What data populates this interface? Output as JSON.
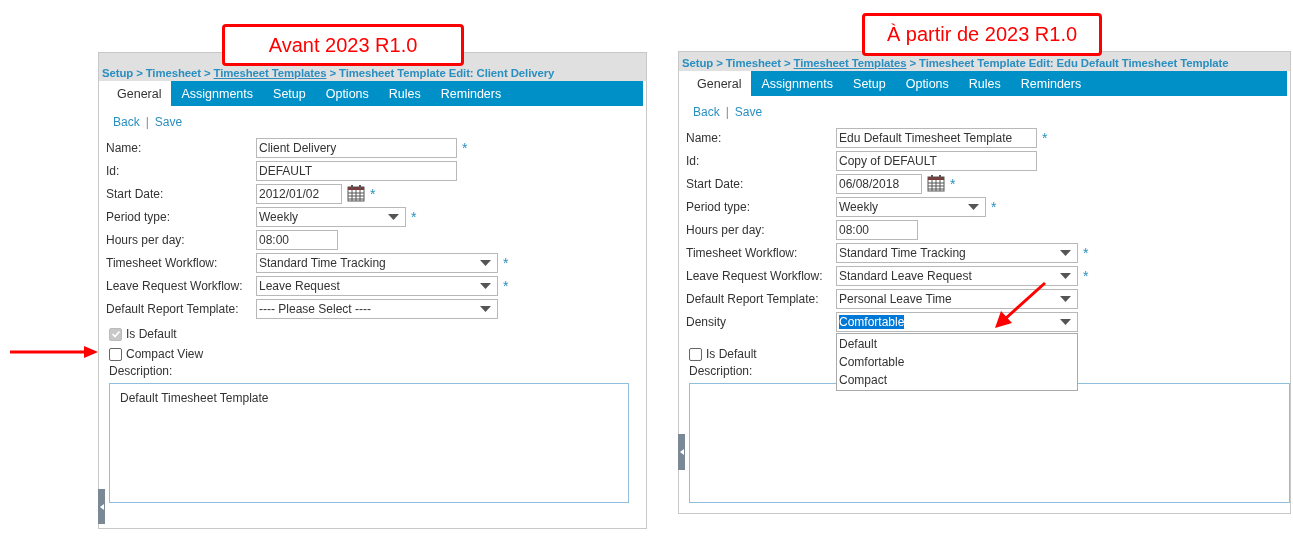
{
  "panels": [
    {
      "banner": "Avant 2023 R1.0",
      "breadcrumb": {
        "separator": ">",
        "items": [
          {
            "text": "Setup",
            "underlined": false
          },
          {
            "text": "Timesheet",
            "underlined": false
          },
          {
            "text": "Timesheet Templates",
            "underlined": true
          },
          {
            "text": "Timesheet Template Edit: Client Delivery",
            "underlined": false
          }
        ]
      },
      "tabs": [
        {
          "label": "General",
          "selected": true
        },
        {
          "label": "Assignments",
          "selected": false
        },
        {
          "label": "Setup",
          "selected": false
        },
        {
          "label": "Options",
          "selected": false
        },
        {
          "label": "Rules",
          "selected": false
        },
        {
          "label": "Reminders",
          "selected": false
        }
      ],
      "actions": {
        "separator": "|",
        "links": [
          "Back",
          "Save"
        ]
      },
      "fields": [
        {
          "label": "Name:",
          "value": "Client Delivery",
          "kind": "text",
          "required_mark": "*"
        },
        {
          "label": "Id:",
          "value": "DEFAULT",
          "kind": "text"
        },
        {
          "label": "Start Date:",
          "value": "2012/01/02",
          "kind": "date",
          "required_mark": "*"
        },
        {
          "label": "Period type:",
          "value": "Weekly",
          "kind": "dropdown",
          "required_mark": "*"
        },
        {
          "label": "Hours per day:",
          "value": "08:00",
          "kind": "time"
        },
        {
          "label": "Timesheet Workflow:",
          "value": "Standard Time Tracking",
          "kind": "wide-dropdown",
          "required_mark": "*"
        },
        {
          "label": "Leave Request Workflow:",
          "value": "Leave Request",
          "kind": "wide-dropdown",
          "required_mark": "*"
        },
        {
          "label": "Default Report Template:",
          "value": "---- Please Select ----",
          "kind": "wide-dropdown"
        }
      ],
      "checkboxes": [
        {
          "label": "Is Default",
          "checked": true,
          "disabled": true
        },
        {
          "label": "Compact View",
          "checked": false,
          "disabled": false
        }
      ],
      "description": {
        "label": "Description:",
        "value": "Default Timesheet Template"
      }
    },
    {
      "banner": "À partir de 2023 R1.0",
      "breadcrumb": {
        "separator": ">",
        "items": [
          {
            "text": "Setup",
            "underlined": false
          },
          {
            "text": "Timesheet",
            "underlined": false
          },
          {
            "text": "Timesheet Templates",
            "underlined": true
          },
          {
            "text": "Timesheet Template Edit: Edu Default Timesheet Template",
            "underlined": false
          }
        ]
      },
      "tabs": [
        {
          "label": "General",
          "selected": true
        },
        {
          "label": "Assignments",
          "selected": false
        },
        {
          "label": "Setup",
          "selected": false
        },
        {
          "label": "Options",
          "selected": false
        },
        {
          "label": "Rules",
          "selected": false
        },
        {
          "label": "Reminders",
          "selected": false
        }
      ],
      "actions": {
        "separator": "|",
        "links": [
          "Back",
          "Save"
        ]
      },
      "fields": [
        {
          "label": "Name:",
          "value": "Edu Default Timesheet Template",
          "kind": "text",
          "required_mark": "*"
        },
        {
          "label": "Id:",
          "value": "Copy of DEFAULT",
          "kind": "text"
        },
        {
          "label": "Start Date:",
          "value": "06/08/2018",
          "kind": "date",
          "required_mark": "*"
        },
        {
          "label": "Period type:",
          "value": "Weekly",
          "kind": "dropdown",
          "required_mark": "*"
        },
        {
          "label": "Hours per day:",
          "value": "08:00",
          "kind": "time"
        },
        {
          "label": "Timesheet Workflow:",
          "value": "Standard Time Tracking",
          "kind": "wide-dropdown",
          "required_mark": "*"
        },
        {
          "label": "Leave Request Workflow:",
          "value": "Standard Leave Request",
          "kind": "wide-dropdown",
          "required_mark": "*"
        },
        {
          "label": "Default Report Template:",
          "value": "Personal Leave Time",
          "kind": "wide-dropdown"
        },
        {
          "label": "Density",
          "value": "Comfortable",
          "kind": "wide-dropdown",
          "highlighted": true,
          "options": [
            "Default",
            "Comfortable",
            "Compact"
          ]
        }
      ],
      "checkboxes": [
        {
          "label": "Is Default",
          "checked": false,
          "disabled": false
        }
      ],
      "description": {
        "label": "Description:"
      }
    }
  ]
}
